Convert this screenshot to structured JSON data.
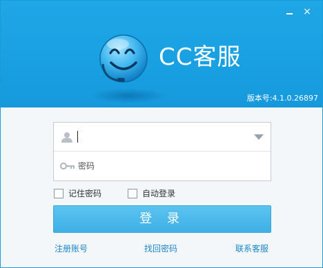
{
  "window": {
    "minimize_label": "",
    "close_label": "×"
  },
  "header": {
    "title": "CC客服",
    "version": "版本号:4.1.0.26897"
  },
  "form": {
    "username": {
      "value": "",
      "placeholder": ""
    },
    "password": {
      "placeholder": "密码"
    },
    "remember_password_label": "记住密码",
    "auto_login_label": "自动登录",
    "login_button_label": "登 录"
  },
  "links": {
    "register": "注册账号",
    "recover_password": "找回密码",
    "contact_support": "联系客服"
  },
  "icons": {
    "logo": "smiley-headset-icon",
    "user": "user-icon",
    "key": "key-icon",
    "dropdown": "chevron-down-icon"
  },
  "colors": {
    "header_bg": "#1ba2e3",
    "login_button": "#4db8ea",
    "link": "#1d86c8"
  }
}
